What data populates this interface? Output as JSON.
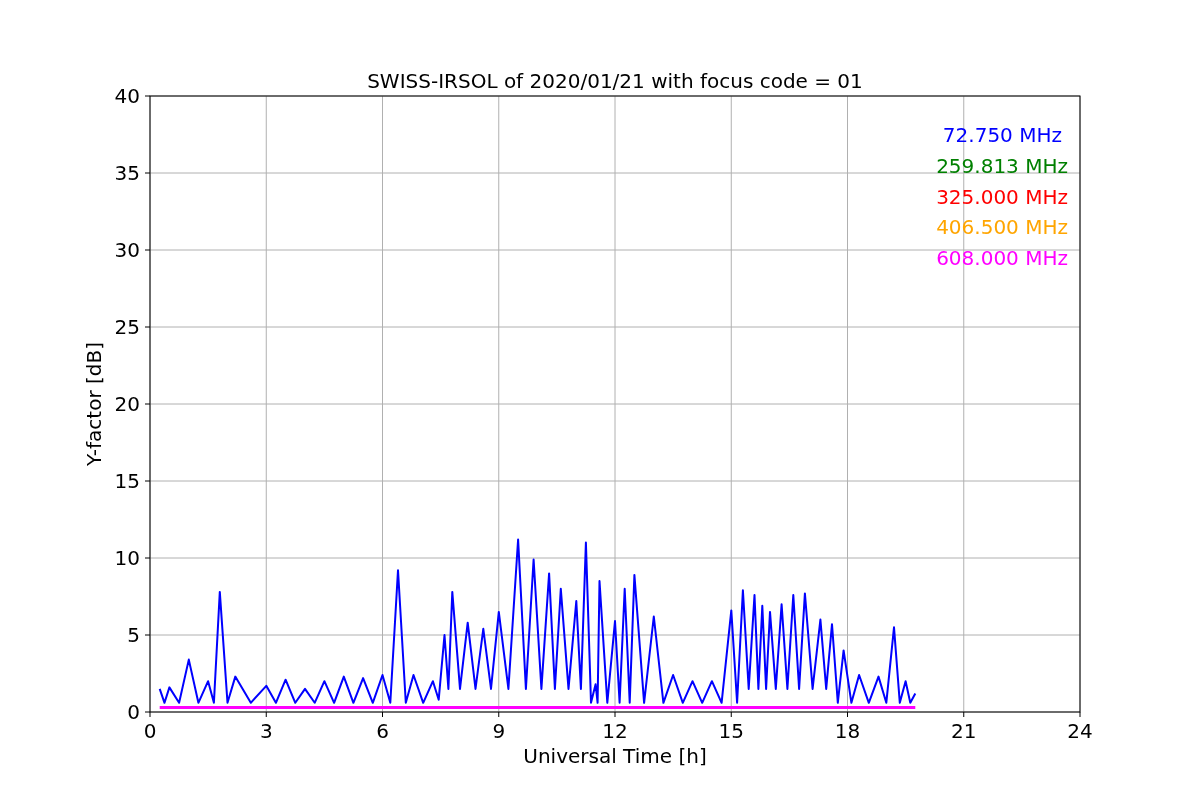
{
  "figure": {
    "chart_data": {
      "type": "line",
      "title": "SWISS-IRSOL of 2020/01/21 with focus code = 01",
      "xlabel": "Universal Time [h]",
      "ylabel": "Y-factor [dB]",
      "xlim": [
        0,
        24
      ],
      "ylim": [
        0,
        40
      ],
      "xticks": [
        0,
        3,
        6,
        9,
        12,
        15,
        18,
        21,
        24
      ],
      "yticks": [
        0,
        5,
        10,
        15,
        20,
        25,
        30,
        35,
        40
      ],
      "grid": true,
      "x": [
        0.25,
        0.375,
        0.5,
        0.75,
        1.0,
        1.25,
        1.5,
        1.65,
        1.8,
        2.0,
        2.2,
        2.6,
        3.0,
        3.25,
        3.5,
        3.75,
        4.0,
        4.25,
        4.5,
        4.75,
        5.0,
        5.25,
        5.5,
        5.75,
        6.0,
        6.2,
        6.4,
        6.6,
        6.8,
        7.05,
        7.3,
        7.45,
        7.6,
        7.7,
        7.8,
        8.0,
        8.2,
        8.4,
        8.6,
        8.8,
        9.0,
        9.25,
        9.5,
        9.7,
        9.9,
        10.1,
        10.3,
        10.45,
        10.6,
        10.8,
        11.0,
        11.12,
        11.25,
        11.38,
        11.5,
        11.55,
        11.6,
        11.8,
        12.0,
        12.12,
        12.25,
        12.38,
        12.5,
        12.75,
        13.0,
        13.25,
        13.5,
        13.75,
        14.0,
        14.25,
        14.5,
        14.75,
        15.0,
        15.15,
        15.3,
        15.45,
        15.6,
        15.7,
        15.8,
        15.9,
        16.0,
        16.15,
        16.3,
        16.45,
        16.6,
        16.75,
        16.9,
        17.1,
        17.3,
        17.45,
        17.6,
        17.75,
        17.9,
        18.1,
        18.3,
        18.55,
        18.8,
        19.0,
        19.2,
        19.35,
        19.5,
        19.62,
        19.75
      ],
      "series": [
        {
          "name": "72.750 MHz",
          "color": "#0000ff",
          "values": [
            1.5,
            0.6,
            1.6,
            0.6,
            3.4,
            0.6,
            2.0,
            0.6,
            7.8,
            0.6,
            2.3,
            0.6,
            1.7,
            0.6,
            2.1,
            0.6,
            1.5,
            0.6,
            2.0,
            0.6,
            2.3,
            0.6,
            2.2,
            0.6,
            2.4,
            0.6,
            9.2,
            0.6,
            2.4,
            0.6,
            2.0,
            0.8,
            5.0,
            1.5,
            7.8,
            1.5,
            5.8,
            1.5,
            5.4,
            1.5,
            6.5,
            1.5,
            11.2,
            1.5,
            9.9,
            1.5,
            9.0,
            1.5,
            8.0,
            1.5,
            7.2,
            1.5,
            11.0,
            0.6,
            1.8,
            0.6,
            8.5,
            0.6,
            5.9,
            0.6,
            8.0,
            0.6,
            8.9,
            0.6,
            6.2,
            0.6,
            2.4,
            0.6,
            2.0,
            0.6,
            2.0,
            0.6,
            6.6,
            0.6,
            7.9,
            1.5,
            7.6,
            1.5,
            6.9,
            1.5,
            6.5,
            1.5,
            7.0,
            1.5,
            7.6,
            1.5,
            7.7,
            1.5,
            6.0,
            1.5,
            5.7,
            0.6,
            4.0,
            0.6,
            2.4,
            0.6,
            2.3,
            0.6,
            5.5,
            0.6,
            2.0,
            0.6,
            1.2
          ]
        },
        {
          "name": "608.000 MHz",
          "color": "#ff00ff",
          "values": [
            0.3,
            0.3,
            0.3,
            0.3,
            0.3,
            0.3,
            0.3,
            0.3,
            0.3,
            0.3,
            0.3,
            0.3,
            0.3,
            0.3,
            0.3,
            0.3,
            0.3,
            0.3,
            0.3,
            0.3,
            0.3,
            0.3,
            0.3,
            0.3,
            0.3,
            0.3,
            0.3,
            0.3,
            0.3,
            0.3,
            0.3,
            0.3,
            0.3,
            0.3,
            0.3,
            0.3,
            0.3,
            0.3,
            0.3,
            0.3,
            0.3,
            0.3,
            0.3,
            0.3,
            0.3,
            0.3,
            0.3,
            0.3,
            0.3,
            0.3,
            0.3,
            0.3,
            0.3,
            0.3,
            0.3,
            0.3,
            0.3,
            0.3,
            0.3,
            0.3,
            0.3,
            0.3,
            0.3,
            0.3,
            0.3,
            0.3,
            0.3,
            0.3,
            0.3,
            0.3,
            0.3,
            0.3,
            0.3,
            0.3,
            0.3,
            0.3,
            0.3,
            0.3,
            0.3,
            0.3,
            0.3,
            0.3,
            0.3,
            0.3,
            0.3,
            0.3,
            0.3,
            0.3,
            0.3,
            0.3,
            0.3,
            0.3,
            0.3,
            0.3,
            0.3,
            0.3,
            0.3,
            0.3,
            0.3,
            0.3,
            0.3,
            0.3,
            0.3
          ]
        }
      ]
    },
    "legend_hidden_series": [
      {
        "label": "259.813 MHz",
        "color": "#008000"
      },
      {
        "label": "325.000 MHz",
        "color": "#ff0000"
      },
      {
        "label": "406.500 MHz",
        "color": "#ffa500"
      }
    ]
  }
}
